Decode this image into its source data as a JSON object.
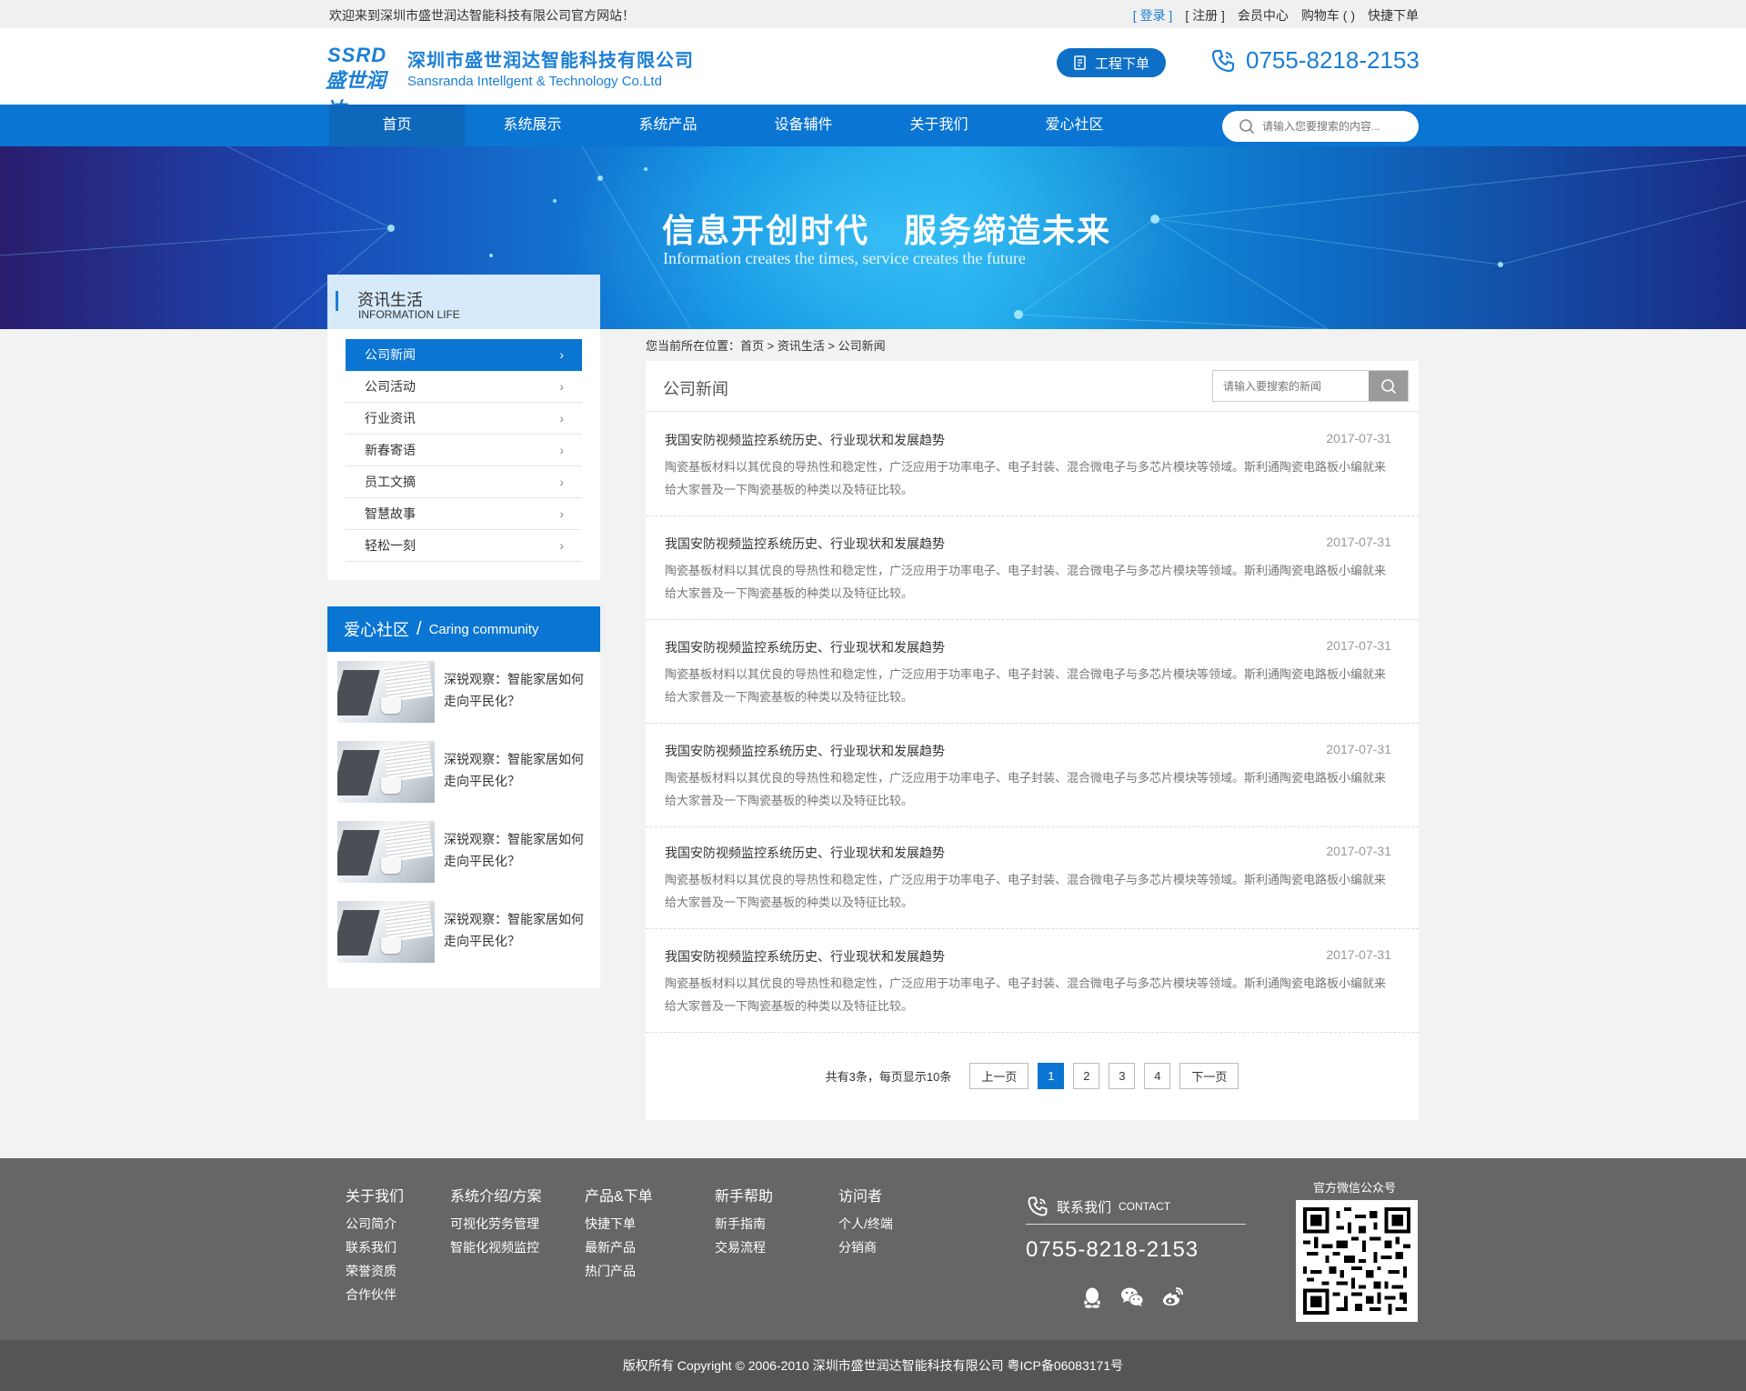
{
  "topbar": {
    "welcome": "欢迎来到深圳市盛世润达智能科技有限公司官方网站！",
    "login": "[ 登录 ]",
    "register": "[ 注册 ]",
    "member": "会员中心",
    "cart": "购物车 ( )",
    "quick_order": "快捷下单"
  },
  "header": {
    "logo_mark_en": "SSRD",
    "logo_mark_cn": "盛世润达",
    "company_cn": "深圳市盛世润达智能科技有限公司",
    "company_en": "Sansranda Intellgent & Technology Co.Ltd",
    "order_button": "工程下单",
    "hotline": "0755-8218-2153"
  },
  "nav": {
    "items": [
      "首页",
      "系统展示",
      "系统产品",
      "设备辅件",
      "关于我们",
      "爱心社区"
    ],
    "search_placeholder": "请输入您要搜索的内容..."
  },
  "banner": {
    "slogan": "信息开创时代　服务缔造未来",
    "slogan_en": "Information creates the times, service creates the future"
  },
  "sidebar": {
    "title_cn": "资讯生活",
    "title_en": "INFORMATION LIFE",
    "menu": [
      "公司新闻",
      "公司活动",
      "行业资讯",
      "新春寄语",
      "员工文摘",
      "智慧故事",
      "轻松一刻"
    ],
    "community_title_cn": "爱心社区",
    "community_slash": "/",
    "community_title_en": "Caring community",
    "community_items": [
      "深锐观察：智能家居如何走向平民化？",
      "深锐观察：智能家居如何走向平民化？",
      "深锐观察：智能家居如何走向平民化？",
      "深锐观察：智能家居如何走向平民化？"
    ]
  },
  "main": {
    "breadcrumb": "您当前所在位置：首页 > 资讯生活 > 公司新闻",
    "title": "公司新闻",
    "search_placeholder": "请输入要搜索的新闻",
    "news": [
      {
        "title": "我国安防视频监控系统历史、行业现状和发展趋势",
        "date": "2017-07-31",
        "summary": "陶瓷基板材料以其优良的导热性和稳定性，广泛应用于功率电子、电子封装、混合微电子与多芯片模块等领域。斯利通陶瓷电路板小编就来给大家普及一下陶瓷基板的种类以及特征比较。"
      },
      {
        "title": "我国安防视频监控系统历史、行业现状和发展趋势",
        "date": "2017-07-31",
        "summary": "陶瓷基板材料以其优良的导热性和稳定性，广泛应用于功率电子、电子封装、混合微电子与多芯片模块等领域。斯利通陶瓷电路板小编就来给大家普及一下陶瓷基板的种类以及特征比较。"
      },
      {
        "title": "我国安防视频监控系统历史、行业现状和发展趋势",
        "date": "2017-07-31",
        "summary": "陶瓷基板材料以其优良的导热性和稳定性，广泛应用于功率电子、电子封装、混合微电子与多芯片模块等领域。斯利通陶瓷电路板小编就来给大家普及一下陶瓷基板的种类以及特征比较。"
      },
      {
        "title": "我国安防视频监控系统历史、行业现状和发展趋势",
        "date": "2017-07-31",
        "summary": "陶瓷基板材料以其优良的导热性和稳定性，广泛应用于功率电子、电子封装、混合微电子与多芯片模块等领域。斯利通陶瓷电路板小编就来给大家普及一下陶瓷基板的种类以及特征比较。"
      },
      {
        "title": "我国安防视频监控系统历史、行业现状和发展趋势",
        "date": "2017-07-31",
        "summary": "陶瓷基板材料以其优良的导热性和稳定性，广泛应用于功率电子、电子封装、混合微电子与多芯片模块等领域。斯利通陶瓷电路板小编就来给大家普及一下陶瓷基板的种类以及特征比较。"
      },
      {
        "title": "我国安防视频监控系统历史、行业现状和发展趋势",
        "date": "2017-07-31",
        "summary": "陶瓷基板材料以其优良的导热性和稳定性，广泛应用于功率电子、电子封装、混合微电子与多芯片模块等领域。斯利通陶瓷电路板小编就来给大家普及一下陶瓷基板的种类以及特征比较。"
      }
    ],
    "pager": {
      "info": "共有3条，每页显示10条",
      "prev": "上一页",
      "pages": [
        "1",
        "2",
        "3",
        "4"
      ],
      "current_page": "1",
      "next": "下一页"
    }
  },
  "footer": {
    "columns": [
      {
        "heading": "关于我们",
        "links": [
          "公司简介",
          "联系我们",
          "荣誉资质",
          "合作伙伴"
        ]
      },
      {
        "heading": "系统介绍/方案",
        "links": [
          "可视化劳务管理",
          "智能化视频监控"
        ]
      },
      {
        "heading": "产品&下单",
        "links": [
          "快捷下单",
          "最新产品",
          "热门产品"
        ]
      },
      {
        "heading": "新手帮助",
        "links": [
          "新手指南",
          "交易流程"
        ]
      },
      {
        "heading": "访问者",
        "links": [
          "个人/终端",
          "分销商"
        ]
      }
    ],
    "contact_title": "联系我们",
    "contact_sub": "CONTACT",
    "phone": "0755-8218-2153",
    "social_icons": [
      "qq-icon",
      "wechat-icon",
      "weibo-icon"
    ],
    "qr_title": "官方微信公众号",
    "copyright": "版权所有  Copyright © 2006-2010  深圳市盛世润达智能科技有限公司  粤ICP备06083171号"
  },
  "colors": {
    "brand_blue": "#0a75d2",
    "footer_gray": "#666666",
    "copyright_gray": "#555555"
  }
}
